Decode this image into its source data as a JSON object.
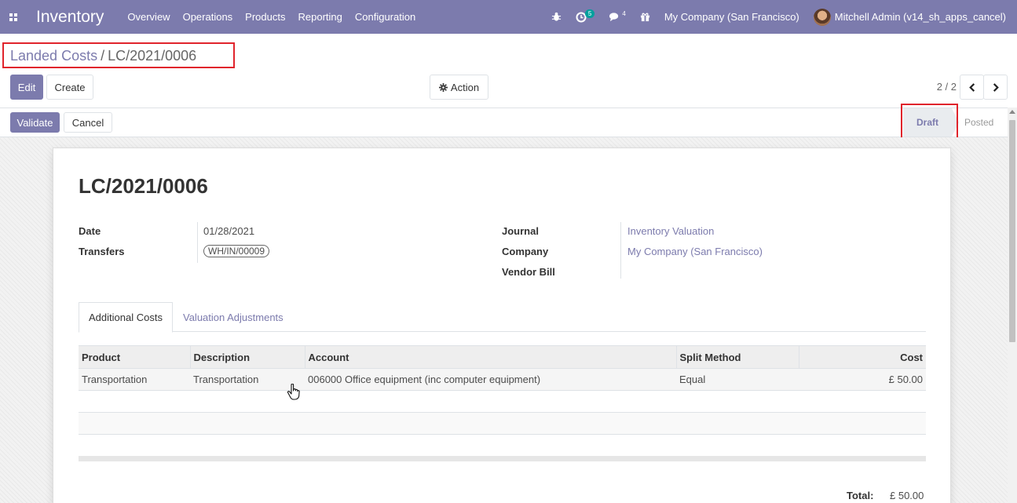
{
  "navbar": {
    "app_name": "Inventory",
    "menu": [
      "Overview",
      "Operations",
      "Products",
      "Reporting",
      "Configuration"
    ],
    "activity_count": "5",
    "messages_count": "4",
    "company": "My Company (San Francisco)",
    "user": "Mitchell Admin (v14_sh_apps_cancel)"
  },
  "breadcrumb": {
    "parent": "Landed Costs",
    "separator": "/",
    "current": "LC/2021/0006"
  },
  "buttons": {
    "edit": "Edit",
    "create": "Create",
    "action": "Action",
    "validate": "Validate",
    "cancel": "Cancel"
  },
  "pager": {
    "value": "2 / 2"
  },
  "status": {
    "draft": "Draft",
    "posted": "Posted"
  },
  "record": {
    "title": "LC/2021/0006",
    "date_label": "Date",
    "date_value": "01/28/2021",
    "transfers_label": "Transfers",
    "transfers_value": "WH/IN/00009",
    "journal_label": "Journal",
    "journal_value": "Inventory Valuation",
    "company_label": "Company",
    "company_value": "My Company (San Francisco)",
    "vendor_bill_label": "Vendor Bill"
  },
  "tabs": {
    "additional_costs": "Additional Costs",
    "valuation_adjustments": "Valuation Adjustments"
  },
  "table": {
    "headers": {
      "product": "Product",
      "description": "Description",
      "account": "Account",
      "split_method": "Split Method",
      "cost": "Cost"
    },
    "rows": [
      {
        "product": "Transportation",
        "description": "Transportation",
        "account": "006000 Office equipment (inc computer equipment)",
        "split_method": "Equal",
        "cost": "£ 50.00"
      }
    ]
  },
  "total": {
    "label": "Total:",
    "value": "£ 50.00"
  },
  "colors": {
    "brand": "#7c7bad",
    "highlight": "#e0242c",
    "badge": "#00a09d"
  }
}
